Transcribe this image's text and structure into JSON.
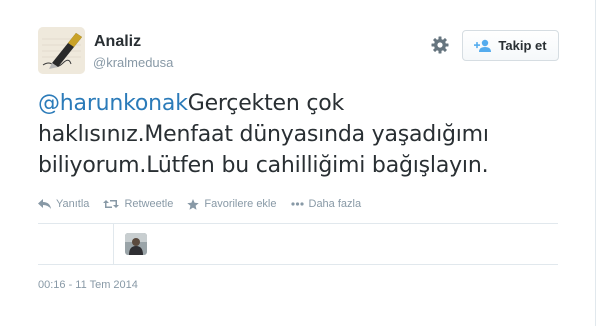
{
  "user": {
    "name": "Analiz",
    "handle": "@kralmedusa"
  },
  "header": {
    "follow_label": "Takip et"
  },
  "tweet": {
    "mention": "@harunkonak",
    "text_line1": "Gerçekten çok",
    "text_line2": "haklısınız.Menfaat dünyasında yaşadığımı",
    "text_line3": "biliyorum.Lütfen bu cahilliğimi bağışlayın."
  },
  "actions": {
    "reply": "Yanıtla",
    "retweet": "Retweetle",
    "favorite": "Favorilere ekle",
    "more": "Daha fazla"
  },
  "timestamp": "00:16 - 11 Tem 2014",
  "colors": {
    "accent": "#2b7bb9",
    "text": "#292f33",
    "muted": "#8899a6",
    "border": "#e1e8ed"
  }
}
